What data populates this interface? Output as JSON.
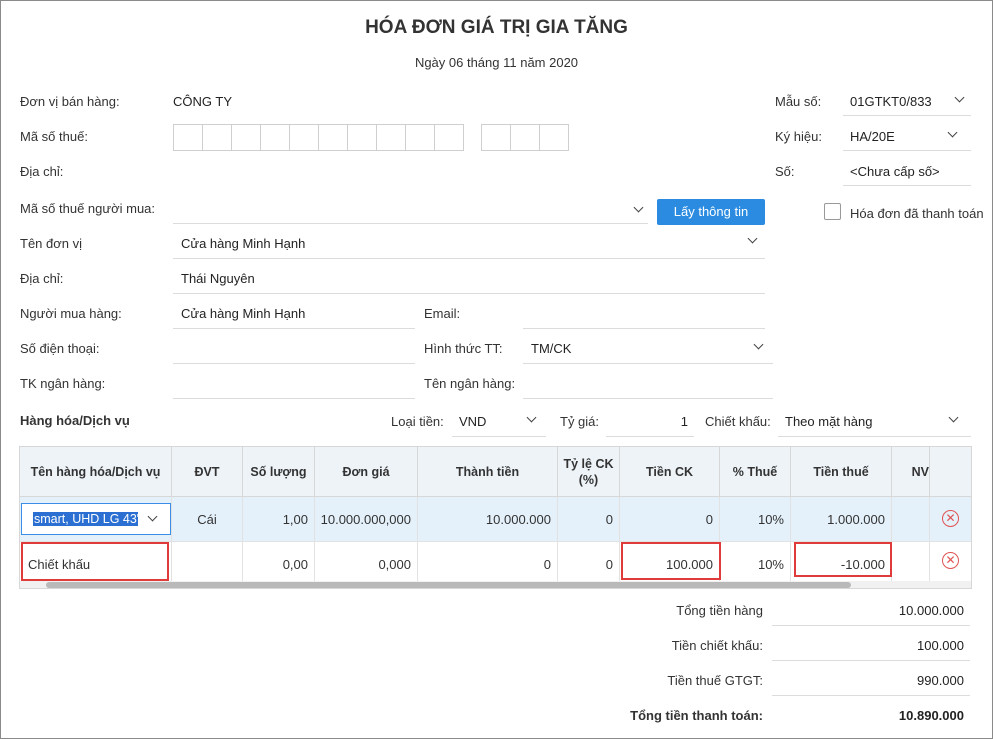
{
  "invoice": {
    "title": "HÓA ĐƠN GIÁ TRỊ GIA TĂNG",
    "date": "Ngày 06 tháng 11 năm 2020"
  },
  "seller": {
    "unit_label": "Đơn vị bán hàng:",
    "unit_value": "CÔNG TY",
    "tax_code_label": "Mã số thuế:",
    "address_label": "Địa chỉ:"
  },
  "meta": {
    "form_label": "Mẫu số:",
    "form_value": "01GTKT0/833",
    "symbol_label": "Ký hiệu:",
    "symbol_value": "HA/20E",
    "number_label": "Số:",
    "number_value": "<Chưa cấp số>",
    "paid_label": "Hóa đơn đã thanh toán"
  },
  "buyer": {
    "tax_code_label": "Mã số thuế người mua:",
    "fetch_button": "Lấy thông tin",
    "unit_label": "Tên đơn vị",
    "unit_value": "Cửa hàng Minh Hạnh",
    "address_label": "Địa chỉ:",
    "address_value": "Thái Nguyên",
    "buyer_label": "Người mua hàng:",
    "buyer_value": "Cửa hàng Minh Hạnh",
    "email_label": "Email:",
    "phone_label": "Số điện thoại:",
    "payment_label": "Hình thức TT:",
    "payment_value": "TM/CK",
    "bank_account_label": "TK ngân hàng:",
    "bank_name_label": "Tên ngân hàng:"
  },
  "goods": {
    "section_label": "Hàng hóa/Dịch vụ",
    "currency_label": "Loại tiền:",
    "currency_value": "VND",
    "rate_label": "Tỷ giá:",
    "rate_value": "1",
    "discount_label": "Chiết khấu:",
    "discount_value": "Theo mặt hàng"
  },
  "table": {
    "headers": [
      "Tên hàng hóa/Dịch vụ",
      "ĐVT",
      "Số lượng",
      "Đơn giá",
      "Thành tiền",
      "Tỷ lệ CK (%)",
      "Tiền CK",
      "% Thuế",
      "Tiền thuế",
      "NV"
    ],
    "rows": [
      {
        "name": "smart, UHD LG 43\"",
        "unit": "Cái",
        "qty": "1,00",
        "price": "10.000.000,000",
        "amount": "10.000.000",
        "disc_rate": "0",
        "disc_amount": "0",
        "tax_rate": "10%",
        "tax_amount": "1.000.000"
      },
      {
        "name": "Chiết khấu",
        "unit": "",
        "qty": "0,00",
        "price": "0,000",
        "amount": "0",
        "disc_rate": "0",
        "disc_amount": "100.000",
        "tax_rate": "10%",
        "tax_amount": "-10.000"
      }
    ]
  },
  "totals": {
    "goods_label": "Tổng tiền hàng",
    "goods_value": "10.000.000",
    "discount_label": "Tiền chiết khấu:",
    "discount_value": "100.000",
    "vat_label": "Tiền thuế GTGT:",
    "vat_value": "990.000",
    "payment_label": "Tổng tiền thanh toán:",
    "payment_value": "10.890.000"
  },
  "colors": {
    "accent": "#2a8be0",
    "highlight_box": "#e03b3b",
    "selected_row": "#e4f1fa"
  }
}
